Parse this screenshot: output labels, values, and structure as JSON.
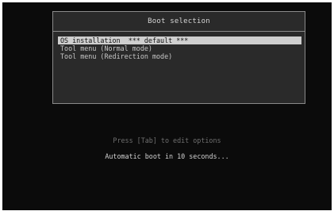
{
  "boot_menu": {
    "title": "Boot selection",
    "items": [
      {
        "label": "OS installation  *** default ***",
        "selected": true
      },
      {
        "label": "Tool menu (Normal mode)",
        "selected": false
      },
      {
        "label": "Tool menu (Redirection mode)",
        "selected": false
      }
    ]
  },
  "footer": {
    "edit_hint": "Press [Tab] to edit options",
    "autoboot_text": "Automatic boot in 10 seconds..."
  },
  "colors": {
    "screen_background": "#0b0b0b",
    "panel_background": "#2a2a2a",
    "selection_highlight": "#cfcfcf"
  }
}
